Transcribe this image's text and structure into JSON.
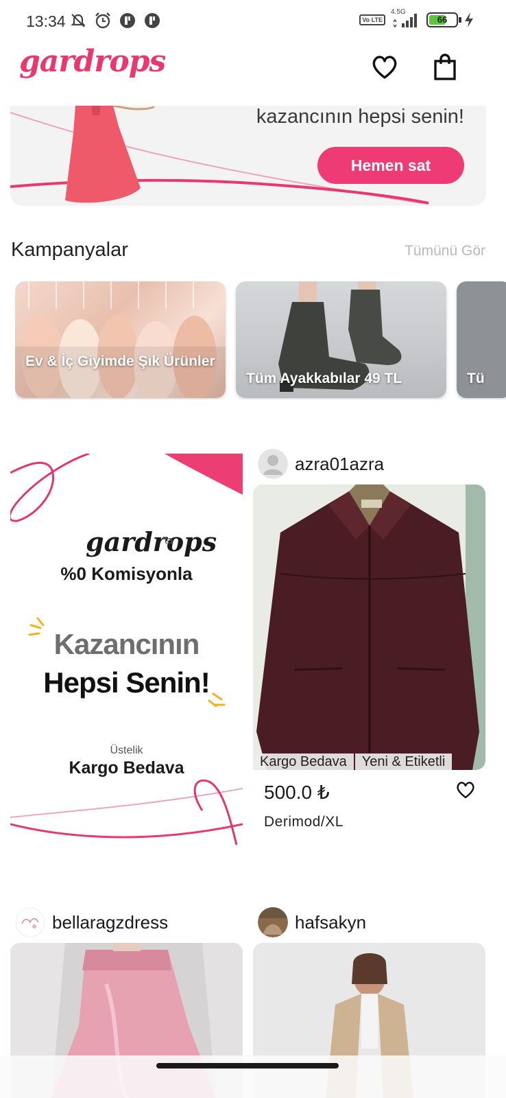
{
  "status_bar": {
    "time": "13:34",
    "network": "4.5G",
    "volte": "Vo LTE",
    "battery": "66",
    "battery_level": 0.66,
    "icons": [
      "mute-icon",
      "alarm-icon",
      "app-notification-icon",
      "app-notification-icon"
    ]
  },
  "header": {
    "logo": "gardrops",
    "icons": [
      "heart-icon",
      "shopping-bag-icon"
    ]
  },
  "hero": {
    "text": "kazancının hepsi senin!",
    "button": "Hemen sat"
  },
  "campaigns": {
    "title": "Kampanyalar",
    "see_all": "Tümünü Gör",
    "items": [
      {
        "label": "Ev & İç Giyimde Şık Ürünler"
      },
      {
        "label": "Tüm Ayakkabılar 49 TL"
      },
      {
        "label": "Tü"
      }
    ]
  },
  "promo": {
    "logo": "gardrops",
    "logo_suffix": "'ta",
    "subtitle": "%0 Komisyonla",
    "headline_1": "Kazancının",
    "headline_2": "Hepsi Senin!",
    "small": "Üstelik",
    "kargo": "Kargo Bedava"
  },
  "products": [
    {
      "seller": "azra01azra",
      "tags": [
        "Kargo Bedava",
        "Yeni & Etiketli"
      ],
      "price": "500.0 ₺",
      "brand": "Derimod/XL"
    },
    {
      "seller": "bellaragzdress"
    },
    {
      "seller": "hafsakyn"
    }
  ],
  "colors": {
    "brand": "#e8386e",
    "button": "#ef3b75"
  }
}
